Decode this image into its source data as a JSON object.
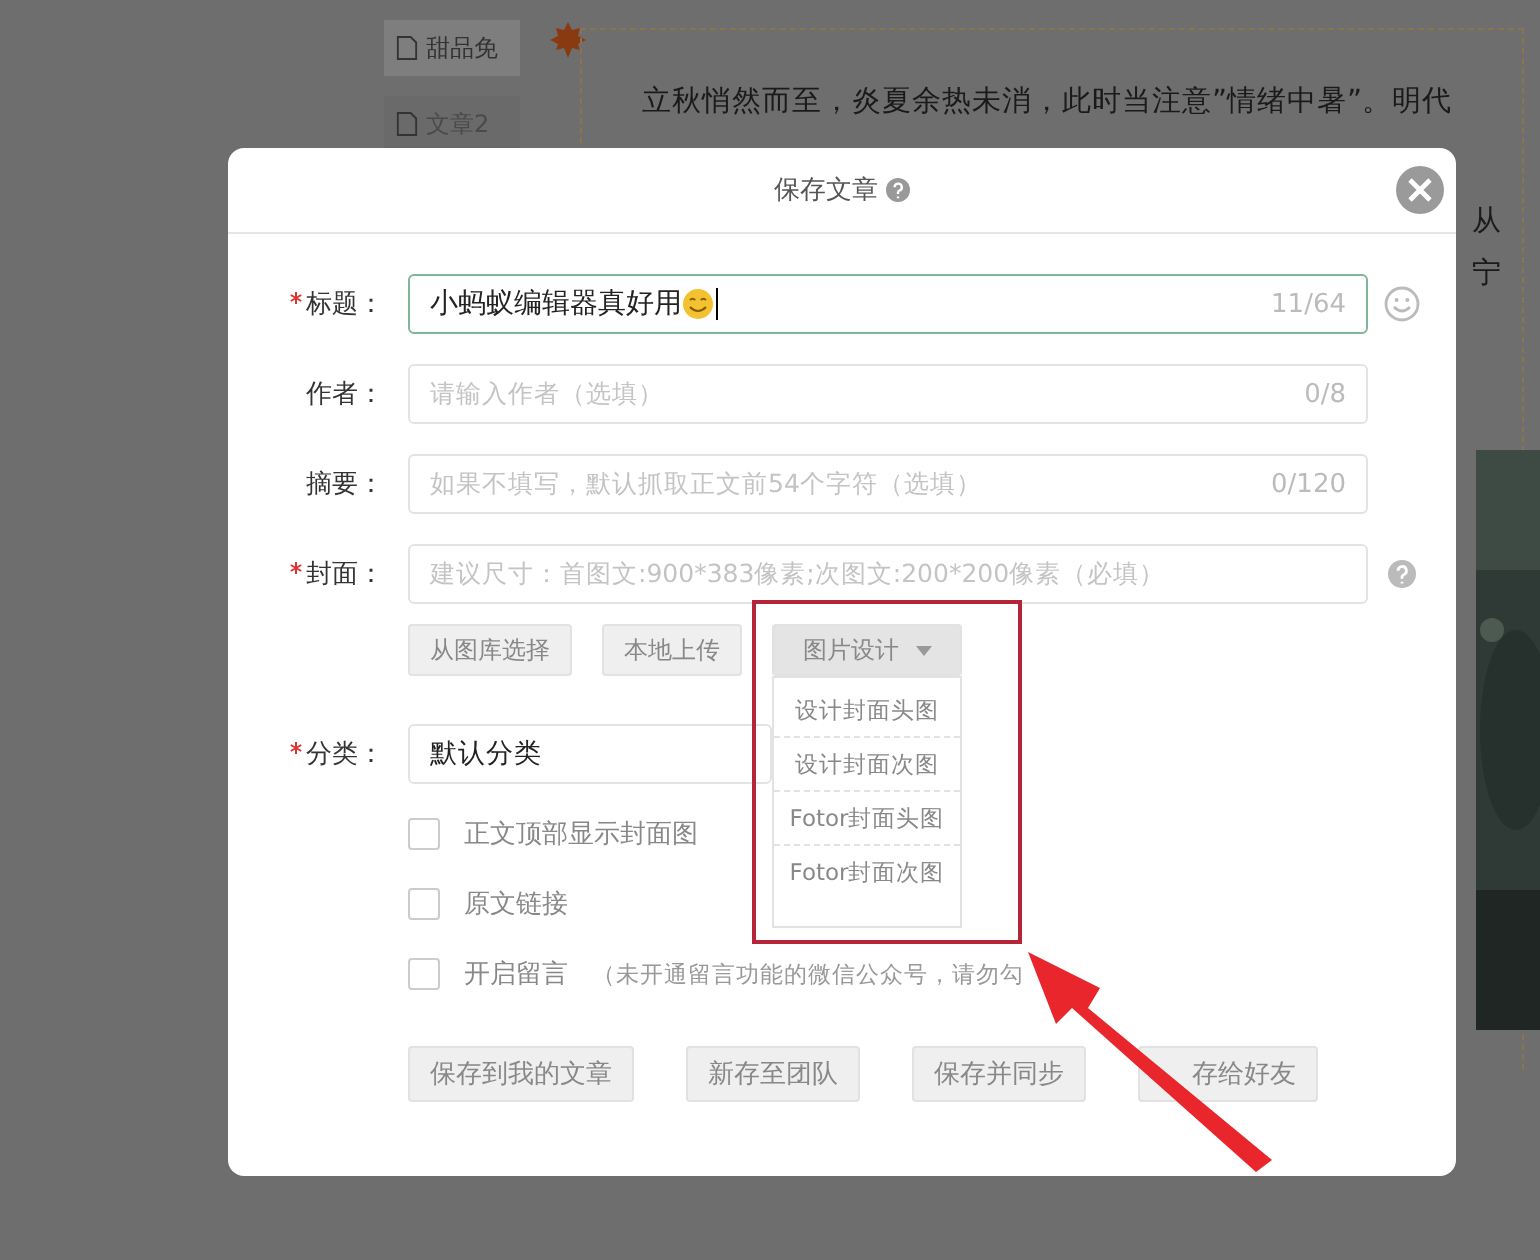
{
  "background": {
    "sidebar_items": [
      {
        "label": "甜品免",
        "selected": true
      },
      {
        "label": "文章2",
        "selected": false
      }
    ],
    "article_lines": [
      "立秋悄然而至，炎夏余热未消，此时当注意”情绪中暑”。明代"
    ],
    "fragments": [
      "从",
      "宁"
    ]
  },
  "dialog": {
    "title": "保存文章",
    "fields": [
      {
        "label": "标题：",
        "required": true,
        "value": "小蚂蚁编辑器真好用",
        "counter": "11/64",
        "focused": true
      },
      {
        "label": "作者：",
        "required": false,
        "placeholder": "请输入作者（选填）",
        "counter": "0/8",
        "focused": false
      },
      {
        "label": "摘要：",
        "required": false,
        "placeholder": "如果不填写，默认抓取正文前54个字符（选填）",
        "counter": "0/120",
        "focused": false
      },
      {
        "label": "封面：",
        "required": true,
        "placeholder": "建议尺寸：首图文:900*383像素;次图文:200*200像素（必填）",
        "focused": false
      }
    ],
    "cover_buttons": [
      {
        "label": "从图库选择",
        "kind": "button"
      },
      {
        "label": "本地上传",
        "kind": "button"
      },
      {
        "label": "图片设计",
        "kind": "dropdown",
        "expanded": true
      }
    ],
    "design_menu": [
      "设计封面头图",
      "设计封面次图",
      "Fotor封面头图",
      "Fotor封面次图"
    ],
    "category": {
      "label": "分类：",
      "required": true,
      "value": "默认分类"
    },
    "options": [
      {
        "label": "正文顶部显示封面图",
        "checked": false
      },
      {
        "label": "原文链接",
        "checked": false
      },
      {
        "label": "开启留言",
        "note": "（未开通留言功能的微信公众号，请勿勾",
        "checked": false
      }
    ],
    "actions": [
      "保存到我的文章",
      "新存至团队",
      "保存并同步",
      "存给好友"
    ]
  }
}
